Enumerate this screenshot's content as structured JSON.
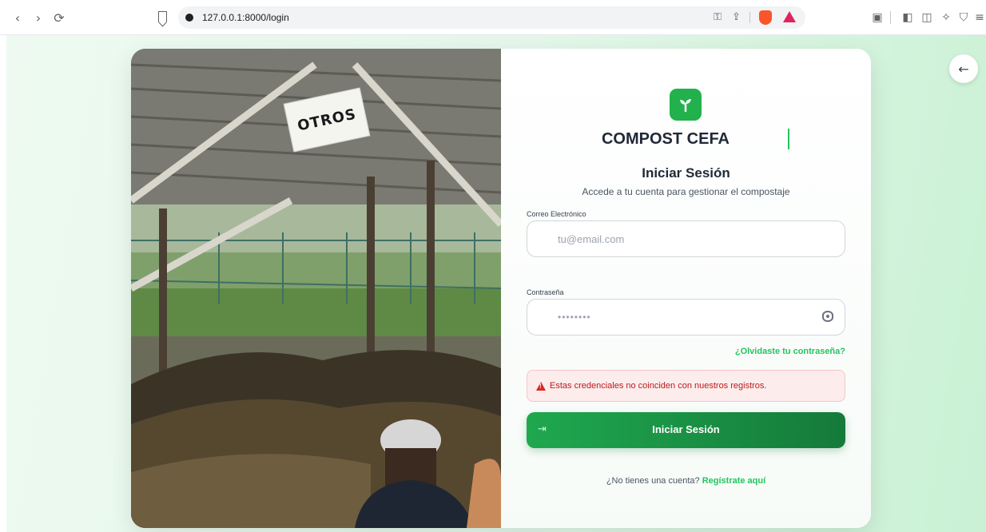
{
  "browser": {
    "url": "127.0.0.1:8000/login",
    "nav_back": "‹",
    "nav_forward": "›",
    "reload": "⟳"
  },
  "page": {
    "back_arrow": "←",
    "photo_sign": "OTROS",
    "brand": "COMPOST CEFA",
    "title": "Iniciar Sesión",
    "subtitle": "Accede a tu cuenta para gestionar el compostaje",
    "email": {
      "label": "Correo Electrónico",
      "placeholder": "tu@email.com"
    },
    "password": {
      "label": "Contraseña",
      "value_masked": "••••••••"
    },
    "forgot_link": "¿Olvidaste tu contraseña?",
    "error_message": "Estas credenciales no coinciden con nuestros registros.",
    "submit_label": "Iniciar Sesión",
    "submit_icon": "⇥",
    "signup_prompt": "¿No tienes una cuenta?",
    "signup_link": "Regístrate aquí"
  },
  "colors": {
    "accent": "#22c55e",
    "button_start": "#1fa84f",
    "button_end": "#157a3a",
    "error": "#b91c1c"
  }
}
